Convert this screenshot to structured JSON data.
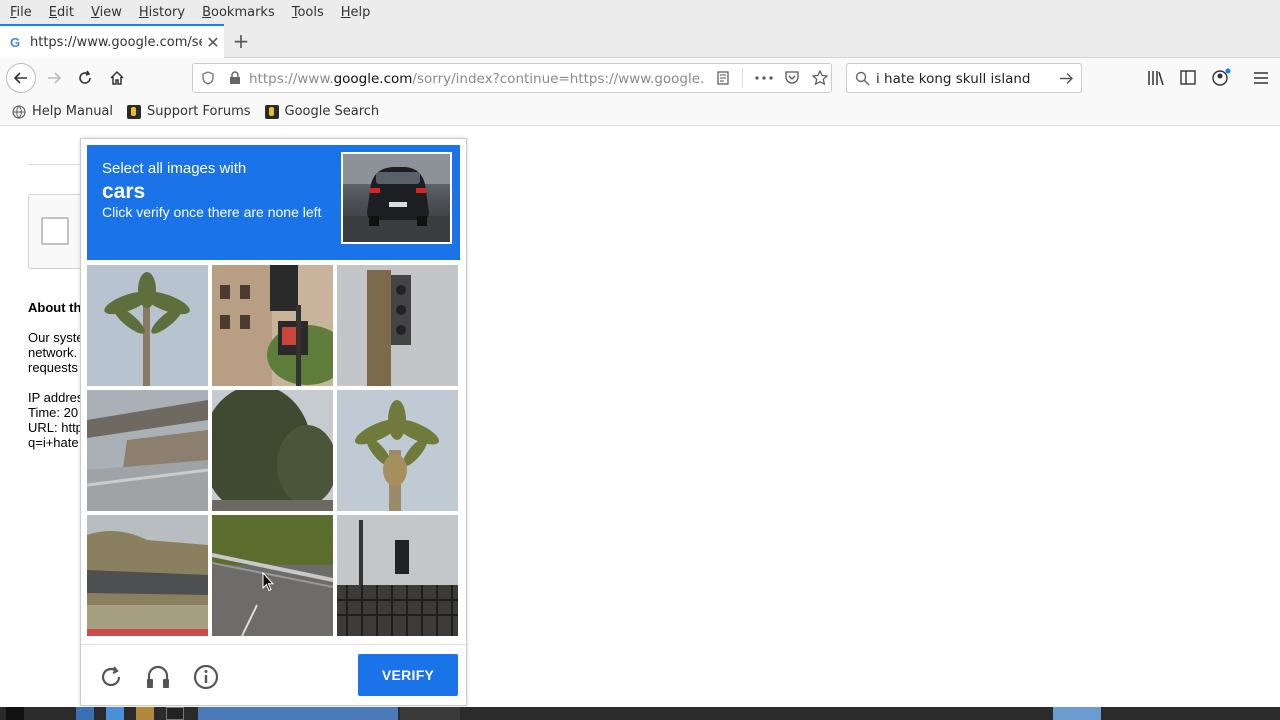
{
  "menu": [
    "File",
    "Edit",
    "View",
    "History",
    "Bookmarks",
    "Tools",
    "Help"
  ],
  "tab": {
    "title": "https://www.google.com/se",
    "favicon": "G"
  },
  "url": {
    "prefix": "https://www.",
    "domain": "google.com",
    "rest": "/sorry/index?continue=https://www.google.com"
  },
  "search": {
    "value": "i hate kong skull island"
  },
  "bookmarks": [
    "Help Manual",
    "Support Forums",
    "Google Search"
  ],
  "page": {
    "about_title": "About th",
    "lines": [
      "Our syste",
      "network.",
      "requests",
      "IP addres",
      "Time: 20",
      "URL: http",
      "q=i+hate"
    ]
  },
  "captcha": {
    "line1": "Select all images with",
    "target": "cars",
    "line3": "Click verify once there are none left",
    "verify_label": "VERIFY",
    "tiles": [
      "palm-tree",
      "traffic-light-building",
      "traffic-light-sky",
      "overpass",
      "tree",
      "palm-tree",
      "bridge",
      "road",
      "traffic-light-fence"
    ]
  },
  "colors": {
    "accent": "#1a73e8",
    "tab_highlight": "#0a84ff"
  }
}
